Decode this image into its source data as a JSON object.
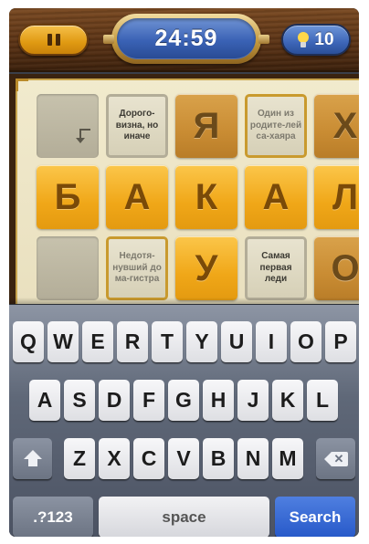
{
  "header": {
    "timer": "24:59",
    "hint_count": "10"
  },
  "board": {
    "row1": [
      {
        "type": "gray"
      },
      {
        "type": "clue",
        "text": "Дорого-визна, но иначе"
      },
      {
        "type": "letter",
        "letter": "Я",
        "dim": true
      },
      {
        "type": "clue",
        "text": "Один из родите-лей са-хаяра",
        "muted": true
      },
      {
        "type": "letter",
        "letter": "Х",
        "dim": true
      }
    ],
    "row2": [
      "Б",
      "А",
      "К",
      "А",
      "Л"
    ],
    "row3": [
      {
        "type": "gray"
      },
      {
        "type": "clue",
        "text": "Недотя-нувший до ма-гистра",
        "muted": true
      },
      {
        "type": "letter",
        "letter": "У"
      },
      {
        "type": "clue",
        "text": "Самая первая леди"
      },
      {
        "type": "letter",
        "letter": "О",
        "dim": true
      }
    ]
  },
  "keyboard": {
    "row1": [
      "Q",
      "W",
      "E",
      "R",
      "T",
      "Y",
      "U",
      "I",
      "O",
      "P"
    ],
    "row2": [
      "A",
      "S",
      "D",
      "F",
      "G",
      "H",
      "J",
      "K",
      "L"
    ],
    "row3": [
      "Z",
      "X",
      "C",
      "V",
      "B",
      "N",
      "M"
    ],
    "numbers_label": ".?123",
    "space_label": "space",
    "search_label": "Search",
    "shift_icon": "shift-arrow",
    "delete_icon": "backspace"
  },
  "colors": {
    "tile_gold": "#f0a718",
    "timer_blue": "#3a62b5",
    "wood": "#5c3416",
    "search_blue": "#2759c9"
  }
}
